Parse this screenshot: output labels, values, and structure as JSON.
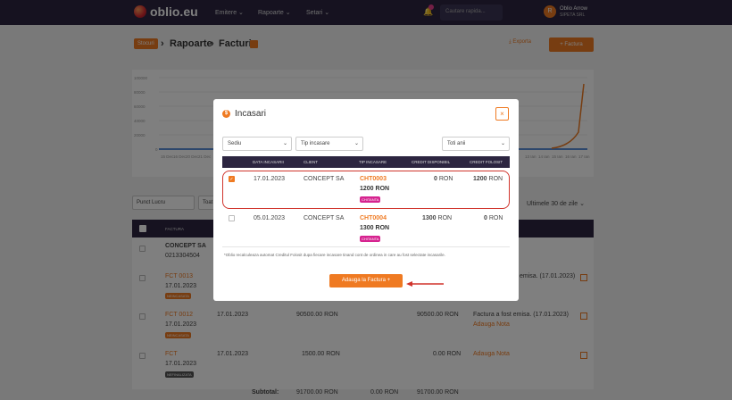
{
  "header": {
    "logo": "oblio.eu",
    "nav": [
      "Emitere ⌄",
      "Rapoarte ⌄",
      "Setari ⌄"
    ],
    "search_placeholder": "Cautare rapida...",
    "user_initial": "R",
    "user_name": "Oblio Arrow",
    "user_company": "SIPETA SRL"
  },
  "breadcrumb": {
    "badge": "Stocuri",
    "items": [
      "Rapoarte",
      "Facturi"
    ]
  },
  "toolbar": {
    "export": "Exporta",
    "factura": "+ Factura"
  },
  "background": {
    "chart_y_ticks": [
      "100000",
      "80000",
      "60000",
      "40000",
      "20000",
      "0"
    ],
    "chart_x_left": [
      "15 Dec",
      "16 Dec",
      "20 Dec",
      "21 Dec"
    ],
    "chart_x_right": [
      "13 Ian",
      "14 Ian",
      "15 Ian",
      "16 Ian",
      "17 Ian"
    ],
    "filter_punct": "Punct Lucru",
    "filter_toate": "Toat",
    "filter_period": "Ultimele 30 de zile ⌄",
    "col_factura": "FACTURA",
    "rows": [
      {
        "title": "CONCEPT SA",
        "sub": "0213304504"
      },
      {
        "title": "FCT 0013",
        "date": "17.01.2023",
        "tag": "NEINCASATA",
        "status": "emisa. (17.01.2023)"
      },
      {
        "title": "FCT 0012",
        "date": "17.01.2023",
        "tag": "NEINCASATA",
        "d2": "17.01.2023",
        "amount": "90500.00 RON",
        "amount2": "90500.00 RON",
        "status": "Factura a fost emisa. (17.01.2023)",
        "link": "Adauga Nota"
      },
      {
        "title": "FCT",
        "date": "17.01.2023",
        "tag": "NEFINALIZATA",
        "d2": "17.01.2023",
        "amount": "1500.00 RON",
        "amount2": "0.00 RON",
        "link": "Adauga Nota"
      }
    ],
    "subtotal_label": "Subtotal:",
    "subtotal_values": [
      "91700.00 RON",
      "0.00 RON",
      "91700.00 RON"
    ]
  },
  "modal": {
    "title": "Incasari",
    "close": "×",
    "filters": {
      "sediu": "Sediu",
      "tip": "Tip incasare",
      "ani": "Toti anii"
    },
    "columns": [
      "DATA INCASARII",
      "CLIENT",
      "TIP INCASARE",
      "CREDIT DISPONIBIL",
      "CREDIT FOLOSIT"
    ],
    "rows": [
      {
        "checked": true,
        "date": "17.01.2023",
        "client": "CONCEPT SA",
        "doc": "CHT0003",
        "doc_amount": "1200 RON",
        "tag": "CHITANTA",
        "credit_disp": "0",
        "credit_folosit": "1200",
        "unit": "RON"
      },
      {
        "checked": false,
        "date": "05.01.2023",
        "client": "CONCEPT SA",
        "doc": "CHT0004",
        "doc_amount": "1300 RON",
        "tag": "CHITANTA",
        "credit_disp": "1300",
        "credit_folosit": "0",
        "unit": "RON"
      }
    ],
    "note": "*Oblio recalculeaza automat Creditul Folosit dupa fiecare incasare tinand cont de ordinea in care au fost selectate incasarile.",
    "button": "Adauga la Factura  +"
  },
  "colors": {
    "accent": "#ef7a22",
    "navy": "#2c2540",
    "highlight": "#d0342c",
    "tag": "#d6238f"
  }
}
